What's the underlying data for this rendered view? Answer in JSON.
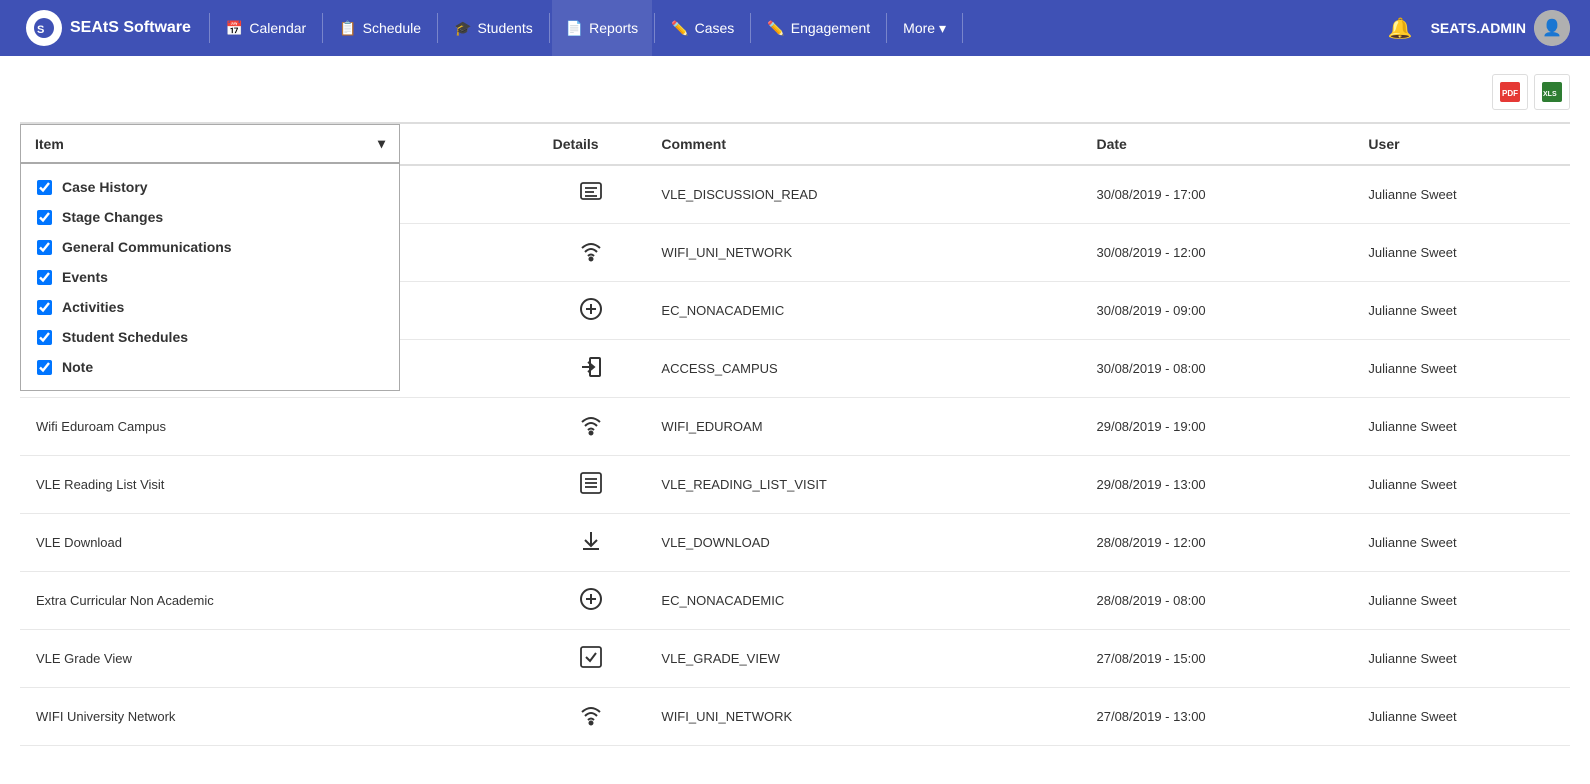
{
  "brand": {
    "name": "SEAtS Software"
  },
  "nav": {
    "items": [
      {
        "label": "Calendar",
        "icon": "calendar-icon"
      },
      {
        "label": "Schedule",
        "icon": "schedule-icon"
      },
      {
        "label": "Students",
        "icon": "students-icon"
      },
      {
        "label": "Reports",
        "icon": "reports-icon",
        "active": true
      },
      {
        "label": "Cases",
        "icon": "cases-icon"
      },
      {
        "label": "Engagement",
        "icon": "engagement-icon"
      },
      {
        "label": "More ▾",
        "icon": "more-icon"
      }
    ],
    "user": "SEATS.ADMIN"
  },
  "toolbar": {
    "pdf_label": "PDF",
    "excel_label": "Excel"
  },
  "table": {
    "item_label": "Item",
    "columns": [
      "Details",
      "Comment",
      "Date",
      "User"
    ],
    "filter_items": [
      {
        "label": "Case History",
        "checked": true
      },
      {
        "label": "Stage Changes",
        "checked": true
      },
      {
        "label": "General Communications",
        "checked": true
      },
      {
        "label": "Events",
        "checked": true
      },
      {
        "label": "Activities",
        "checked": true
      },
      {
        "label": "Student Schedules",
        "checked": true
      },
      {
        "label": "Note",
        "checked": true
      }
    ],
    "rows": [
      {
        "item": "",
        "icon": "discussion",
        "comment": "VLE_DISCUSSION_READ",
        "date": "30/08/2019 - 17:00",
        "user": "Julianne Sweet"
      },
      {
        "item": "",
        "icon": "wifi",
        "comment": "WIFI_UNI_NETWORK",
        "date": "30/08/2019 - 12:00",
        "user": "Julianne Sweet"
      },
      {
        "item": "",
        "icon": "plus-circle",
        "comment": "EC_NONACADEMIC",
        "date": "30/08/2019 - 09:00",
        "user": "Julianne Sweet"
      },
      {
        "item": "",
        "icon": "signin",
        "comment": "ACCESS_CAMPUS",
        "date": "30/08/2019 - 08:00",
        "user": "Julianne Sweet"
      },
      {
        "item": "Wifi Eduroam Campus",
        "icon": "wifi",
        "comment": "WIFI_EDUROAM",
        "date": "29/08/2019 - 19:00",
        "user": "Julianne Sweet"
      },
      {
        "item": "VLE Reading List Visit",
        "icon": "list",
        "comment": "VLE_READING_LIST_VISIT",
        "date": "29/08/2019 - 13:00",
        "user": "Julianne Sweet"
      },
      {
        "item": "VLE Download",
        "icon": "download",
        "comment": "VLE_DOWNLOAD",
        "date": "28/08/2019 - 12:00",
        "user": "Julianne Sweet"
      },
      {
        "item": "Extra Curricular Non Academic",
        "icon": "plus-circle",
        "comment": "EC_NONACADEMIC",
        "date": "28/08/2019 - 08:00",
        "user": "Julianne Sweet"
      },
      {
        "item": "VLE Grade View",
        "icon": "grade",
        "comment": "VLE_GRADE_VIEW",
        "date": "27/08/2019 - 15:00",
        "user": "Julianne Sweet"
      },
      {
        "item": "WIFI University Network",
        "icon": "wifi",
        "comment": "WIFI_UNI_NETWORK",
        "date": "27/08/2019 - 13:00",
        "user": "Julianne Sweet"
      }
    ]
  }
}
